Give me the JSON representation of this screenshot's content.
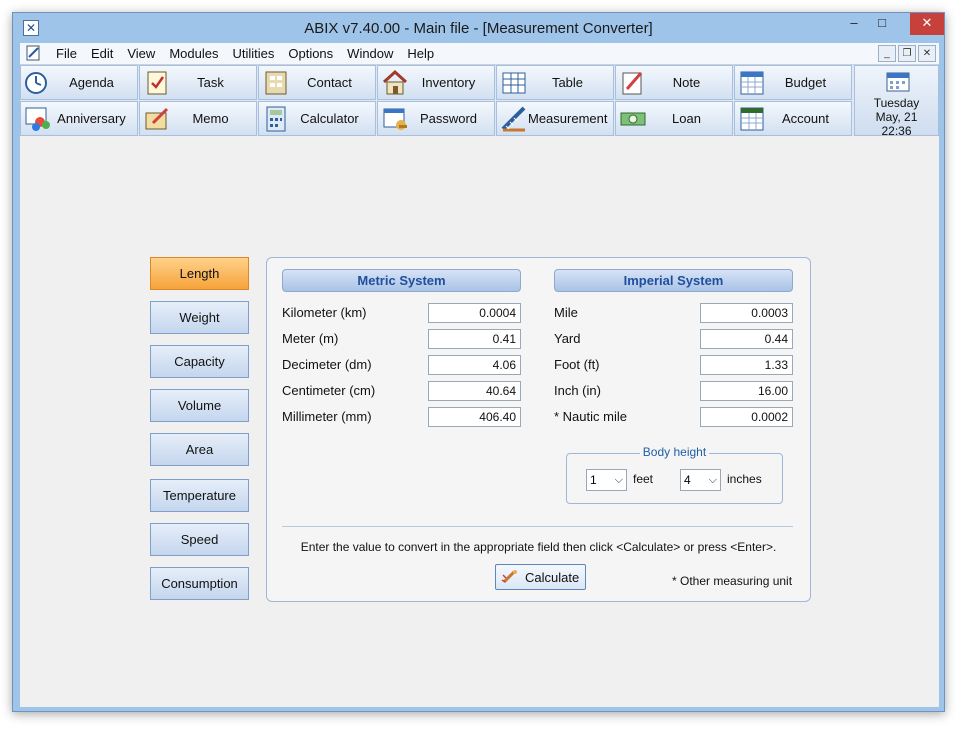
{
  "window": {
    "title": "ABIX v7.40.00  -  Main file - [Measurement Converter]"
  },
  "menu": [
    "File",
    "Edit",
    "View",
    "Modules",
    "Utilities",
    "Options",
    "Window",
    "Help"
  ],
  "toolbar": {
    "row1": [
      {
        "label": "Agenda",
        "icon": "agenda-icon"
      },
      {
        "label": "Task",
        "icon": "task-icon"
      },
      {
        "label": "Contact",
        "icon": "contact-icon"
      },
      {
        "label": "Inventory",
        "icon": "inventory-icon"
      },
      {
        "label": "Table",
        "icon": "table-icon"
      },
      {
        "label": "Note",
        "icon": "note-icon"
      },
      {
        "label": "Budget",
        "icon": "budget-icon"
      }
    ],
    "row2": [
      {
        "label": "Anniversary",
        "icon": "anniversary-icon"
      },
      {
        "label": "Memo",
        "icon": "memo-icon"
      },
      {
        "label": "Calculator",
        "icon": "calculator-icon"
      },
      {
        "label": "Password",
        "icon": "password-icon"
      },
      {
        "label": "Measurement",
        "icon": "measurement-icon"
      },
      {
        "label": "Loan",
        "icon": "loan-icon"
      },
      {
        "label": "Account",
        "icon": "account-icon"
      }
    ],
    "date": {
      "day": "Tuesday",
      "date": "May, 21",
      "time": "22:36"
    }
  },
  "categories": [
    {
      "label": "Length",
      "active": true
    },
    {
      "label": "Weight",
      "active": false
    },
    {
      "label": "Capacity",
      "active": false
    },
    {
      "label": "Volume",
      "active": false
    },
    {
      "label": "Area",
      "active": false
    },
    {
      "label": "Temperature",
      "active": false
    },
    {
      "label": "Speed",
      "active": false
    },
    {
      "label": "Consumption",
      "active": false
    }
  ],
  "metric": {
    "header": "Metric System",
    "rows": [
      {
        "label": "Kilometer (km)",
        "value": "0.0004"
      },
      {
        "label": "Meter (m)",
        "value": "0.41"
      },
      {
        "label": "Decimeter (dm)",
        "value": "4.06"
      },
      {
        "label": "Centimeter (cm)",
        "value": "40.64"
      },
      {
        "label": "Millimeter (mm)",
        "value": "406.40"
      }
    ]
  },
  "imperial": {
    "header": "Imperial System",
    "rows": [
      {
        "label": "Mile",
        "value": "0.0003"
      },
      {
        "label": "Yard",
        "value": "0.44"
      },
      {
        "label": "Foot (ft)",
        "value": "1.33"
      },
      {
        "label": "Inch (in)",
        "value": "16.00"
      },
      {
        "label": "* Nautic mile",
        "value": "0.0002"
      }
    ]
  },
  "body_height": {
    "legend": "Body height",
    "feet_value": "1",
    "feet_label": "feet",
    "inches_value": "4",
    "inches_label": "inches"
  },
  "instruction": "Enter the value to convert in the appropriate field then click <Calculate> or press <Enter>.",
  "calculate_label": "Calculate",
  "note": "* Other measuring unit",
  "colors": {
    "accent": "#1f5ea8",
    "active_tab": "#f6a33a",
    "titlebar": "#9fc4ea"
  }
}
